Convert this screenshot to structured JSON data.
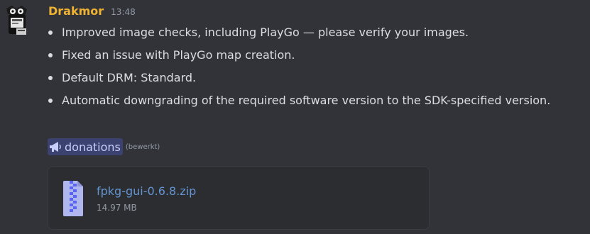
{
  "message": {
    "username": "Drakmor",
    "timestamp": "13:48",
    "bullets": [
      "Improved image checks, including PlayGo — please verify your images.",
      "Fixed an issue with PlayGo map creation.",
      "Default DRM: Standard.",
      "Automatic downgrading of the required software version to the SDK-specified version."
    ],
    "channel_mention": "donations",
    "edited_label": "(bewerkt)"
  },
  "attachment": {
    "file_name": "fpkg-gui-0.6.8.zip",
    "file_size": "14.97 MB"
  },
  "icons": {
    "avatar": "avatar-icon",
    "channel": "megaphone-icon",
    "file": "zip-file-icon"
  },
  "colors": {
    "background": "#323339",
    "username": "#f0b232",
    "mention_bg": "#3c4270",
    "mention_text": "#c9cdfb",
    "link": "#6fa8ec"
  }
}
